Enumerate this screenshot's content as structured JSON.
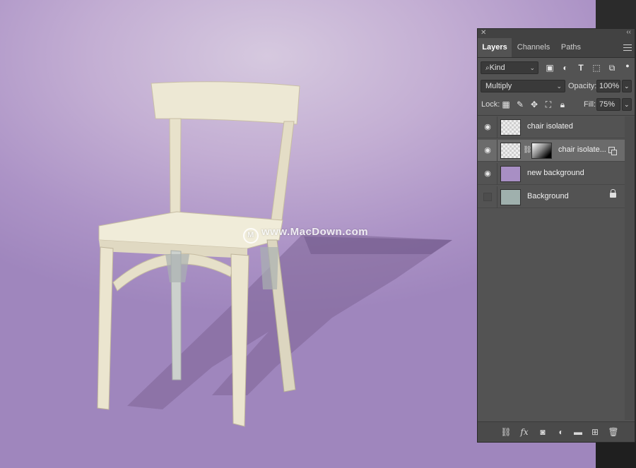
{
  "watermark": {
    "text": "www.MacDown.com",
    "logo": "M"
  },
  "panel": {
    "tabs": [
      {
        "label": "Layers"
      },
      {
        "label": "Channels"
      },
      {
        "label": "Paths"
      }
    ],
    "filter": {
      "value": "Kind",
      "icon": "search-icon"
    },
    "blend_mode": "Multiply",
    "opacity_label": "Opacity:",
    "opacity_value": "100%",
    "lock_label": "Lock:",
    "fill_label": "Fill:",
    "fill_value": "75%",
    "layers": [
      {
        "name": "chair isolated",
        "visible": true,
        "selected": false
      },
      {
        "name": "chair isolate...",
        "visible": true,
        "selected": true
      },
      {
        "name": "new background",
        "visible": true,
        "selected": false
      },
      {
        "name": "Background",
        "visible": false,
        "selected": false,
        "locked": true
      }
    ]
  },
  "colors": {
    "canvas": "#b49bcb",
    "panel": "#535353",
    "selected_layer": "#6b6b6b"
  }
}
